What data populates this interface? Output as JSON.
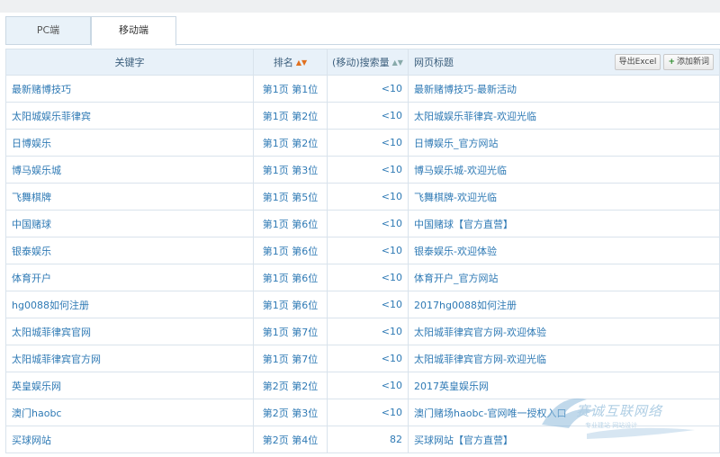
{
  "tabs": [
    {
      "label": "PC端",
      "active": false
    },
    {
      "label": "移动端",
      "active": true
    }
  ],
  "table": {
    "headers": {
      "keyword": "关键字",
      "rank": "排名",
      "volume": "(移动)搜索量",
      "title": "网页标题"
    },
    "export_button": "导出Excel",
    "add_button": "添加新词",
    "rows": [
      {
        "keyword": "最新赌博技巧",
        "rank": "第1页 第1位",
        "volume": "<10",
        "title": "最新赌博技巧-最新活动"
      },
      {
        "keyword": "太阳城娱乐菲律宾",
        "rank": "第1页 第2位",
        "volume": "<10",
        "title": "太阳城娱乐菲律宾-欢迎光临"
      },
      {
        "keyword": "日博娱乐",
        "rank": "第1页 第2位",
        "volume": "<10",
        "title": "日博娱乐_官方网站"
      },
      {
        "keyword": "博马娱乐城",
        "rank": "第1页 第3位",
        "volume": "<10",
        "title": "博马娱乐城-欢迎光临"
      },
      {
        "keyword": "飞舞棋牌",
        "rank": "第1页 第5位",
        "volume": "<10",
        "title": "飞舞棋牌-欢迎光临"
      },
      {
        "keyword": "中国赌球",
        "rank": "第1页 第6位",
        "volume": "<10",
        "title": "中国赌球【官方直营】"
      },
      {
        "keyword": "银泰娱乐",
        "rank": "第1页 第6位",
        "volume": "<10",
        "title": "银泰娱乐-欢迎体验"
      },
      {
        "keyword": "体育开户",
        "rank": "第1页 第6位",
        "volume": "<10",
        "title": "体育开户_官方网站"
      },
      {
        "keyword": "hg0088如何注册",
        "rank": "第1页 第6位",
        "volume": "<10",
        "title": "2017hg0088如何注册"
      },
      {
        "keyword": "太阳城菲律宾官网",
        "rank": "第1页 第7位",
        "volume": "<10",
        "title": "太阳城菲律宾官方网-欢迎体验"
      },
      {
        "keyword": "太阳城菲律宾官方网",
        "rank": "第1页 第7位",
        "volume": "<10",
        "title": "太阳城菲律宾官方网-欢迎光临"
      },
      {
        "keyword": "英皇娱乐网",
        "rank": "第2页 第2位",
        "volume": "<10",
        "title": "2017英皇娱乐网"
      },
      {
        "keyword": "澳门haobc",
        "rank": "第2页 第3位",
        "volume": "<10",
        "title": "澳门赌场haobc-官网唯一授权入口"
      },
      {
        "keyword": "买球网站",
        "rank": "第2页 第4位",
        "volume": "82",
        "title": "买球网站【官方直营】"
      }
    ]
  },
  "watermark": {
    "text": "赛诚互联网络",
    "subtext": "专业建站 网站设计"
  },
  "colors": {
    "header_bg": "#e8f1f9",
    "link_blue": "#2f7ab5",
    "border": "#d9e3ec",
    "sort_orange": "#e07020"
  }
}
